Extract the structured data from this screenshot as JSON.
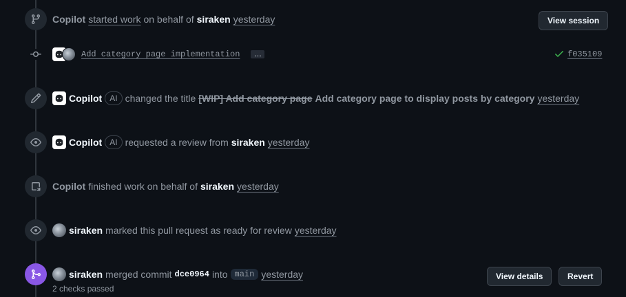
{
  "events": {
    "started": {
      "actor": "Copilot",
      "action": "started work",
      "middle": "on behalf of",
      "user": "siraken",
      "time": "yesterday",
      "button": "View session"
    },
    "commit": {
      "message": "Add category page implementation",
      "more": "…",
      "sha": "f035109"
    },
    "title_change": {
      "actor": "Copilot",
      "ai": "AI",
      "action": "changed the title",
      "old_title": "[WIP] Add category page",
      "new_title": "Add category page to display posts by category",
      "time": "yesterday"
    },
    "review_request": {
      "actor": "Copilot",
      "ai": "AI",
      "action": "requested a review from",
      "user": "siraken",
      "time": "yesterday"
    },
    "finished": {
      "actor": "Copilot",
      "action": "finished work on behalf of",
      "user": "siraken",
      "time": "yesterday"
    },
    "ready": {
      "actor": "siraken",
      "action": "marked this pull request as ready for review",
      "time": "yesterday"
    },
    "merged": {
      "actor": "siraken",
      "action": "merged commit",
      "sha": "dce0964",
      "into": "into",
      "branch": "main",
      "time": "yesterday",
      "checks": "2 checks passed",
      "details_button": "View details",
      "revert_button": "Revert"
    }
  },
  "colors": {
    "background": "#0d1117",
    "merged_badge": "#8957e5",
    "check_green": "#3fb950"
  }
}
